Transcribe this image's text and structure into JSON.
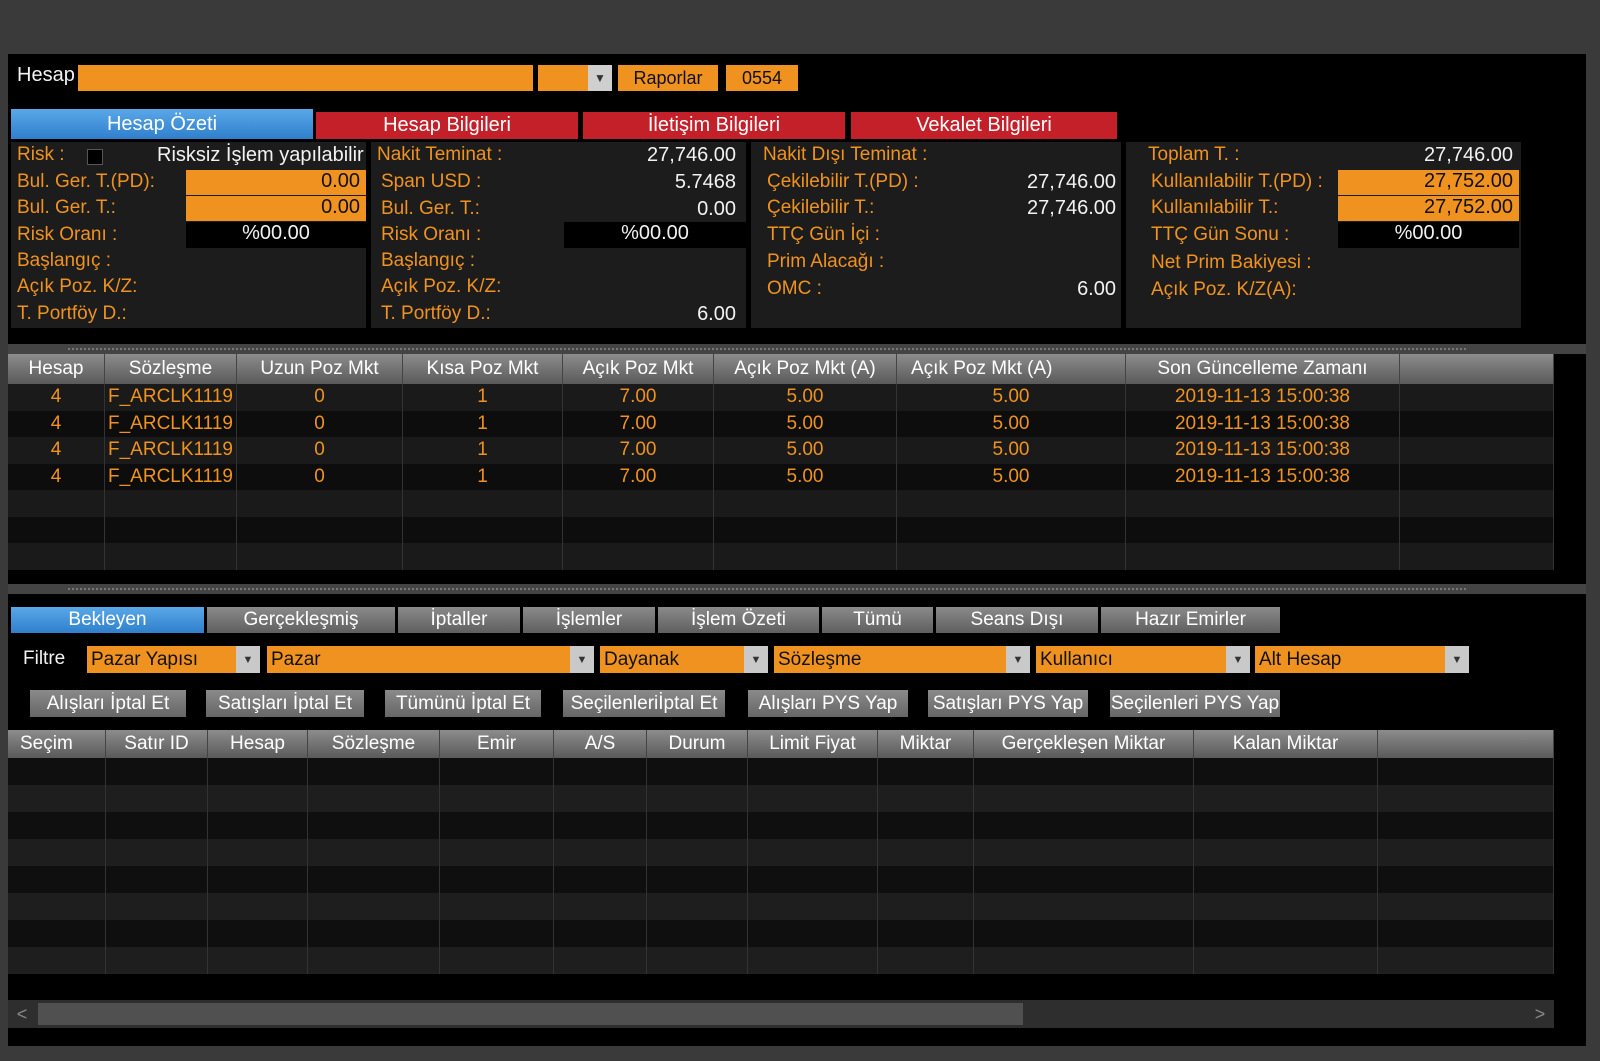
{
  "header": {
    "hesap_label": "Hesap",
    "raporlar_button": "Raporlar",
    "account_code": "0554"
  },
  "tabs": [
    {
      "label": "Hesap Özeti",
      "active": true
    },
    {
      "label": "Hesap Bilgileri"
    },
    {
      "label": "İletişim Bilgileri"
    },
    {
      "label": "Vekalet Bilgileri"
    }
  ],
  "summary": {
    "col1": {
      "risk_label": "Risk :",
      "risk_text": "Risksiz İşlem yapılabilir",
      "bul_ger_pd_label": "Bul. Ger. T.(PD):",
      "bul_ger_pd_value": "0.00",
      "bul_ger_label": "Bul. Ger. T.:",
      "bul_ger_value": "0.00",
      "risk_orani_label": "Risk Oranı :",
      "risk_orani_value": "%00.00",
      "baslangic_label": "Başlangıç  :",
      "acik_poz_label": "Açık Poz. K/Z:",
      "portfoy_label": "T. Portföy D.:"
    },
    "col2": {
      "nakit_label": "Nakit Teminat :",
      "nakit_value": "27,746.00",
      "span_label": "Span USD :",
      "span_value": "5.7468",
      "bul_ger_label": "Bul. Ger. T.:",
      "bul_ger_value": "0.00",
      "risk_orani_label": "Risk Oranı :",
      "risk_orani_value": "%00.00",
      "baslangic_label": "Başlangıç  :",
      "acik_poz_label": "Açık Poz. K/Z:",
      "portfoy_label": "T. Portföy D.:",
      "portfoy_value": "6.00"
    },
    "col3": {
      "nakit_disi_label": "Nakit Dışı  Teminat :",
      "cekilebilir_pd_label": "Çekilebilir T.(PD) :",
      "cekilebilir_pd_value": "27,746.00",
      "cekilebilir_label": "Çekilebilir T.:",
      "cekilebilir_value": "27,746.00",
      "ttc_gun_ici_label": "TTÇ Gün İçi :",
      "prim_alacagi_label": "Prim Alacağı :",
      "omc_label": "OMC :",
      "omc_value": "6.00"
    },
    "col4": {
      "toplam_label": "Toplam T. :",
      "toplam_value": "27,746.00",
      "kullanilabilir_pd_label": "Kullanılabilir T.(PD) :",
      "kullanilabilir_pd_value": "27,752.00",
      "kullanilabilir_label": "Kullanılabilir T.:",
      "kullanilabilir_value": "27,752.00",
      "ttc_gun_sonu_label": "TTÇ Gün Sonu :",
      "ttc_gun_sonu_value": "%00.00",
      "net_prim_label": "Net Prim Bakiyesi :",
      "acik_poz_a_label": "Açık Poz. K/Z(A):"
    }
  },
  "positions": {
    "headers": [
      "Hesap",
      "Sözleşme",
      "Uzun Poz Mkt",
      "Kısa Poz Mkt",
      "Açık Poz Mkt",
      "Açık Poz Mkt (A)",
      "Açık Poz Mkt (A)",
      "Son Güncelleme Zamanı"
    ],
    "rows": [
      [
        "4",
        "F_ARCLK1119",
        "0",
        "1",
        "7.00",
        "5.00",
        "5.00",
        "2019-11-13 15:00:38"
      ],
      [
        "4",
        "F_ARCLK1119",
        "0",
        "1",
        "7.00",
        "5.00",
        "5.00",
        "2019-11-13 15:00:38"
      ],
      [
        "4",
        "F_ARCLK1119",
        "0",
        "1",
        "7.00",
        "5.00",
        "5.00",
        "2019-11-13 15:00:38"
      ],
      [
        "4",
        "F_ARCLK1119",
        "0",
        "1",
        "7.00",
        "5.00",
        "5.00",
        "2019-11-13 15:00:38"
      ]
    ]
  },
  "order_tabs": [
    {
      "label": "Bekleyen",
      "active": true
    },
    {
      "label": "Gerçekleşmiş"
    },
    {
      "label": "İptaller"
    },
    {
      "label": "İşlemler"
    },
    {
      "label": "İşlem Özeti"
    },
    {
      "label": "Tümü"
    },
    {
      "label": "Seans Dışı"
    },
    {
      "label": "Hazır Emirler"
    }
  ],
  "filter": {
    "label": "Filtre",
    "dropdowns": [
      "Pazar Yapısı",
      "Pazar",
      "Dayanak",
      "Sözleşme",
      "Kullanıcı",
      "Alt Hesap"
    ]
  },
  "actions": [
    "Alışları İptal Et",
    "Satışları İptal Et",
    "Tümünü İptal Et",
    "Seçilenleriİptal Et",
    "Alışları PYS Yap",
    "Satışları PYS Yap",
    "Seçilenleri PYS Yap"
  ],
  "orders": {
    "headers": [
      "Seçim",
      "Satır ID",
      "Hesap",
      "Sözleşme",
      "Emir",
      "A/S",
      "Durum",
      "Limit Fiyat",
      "Miktar",
      "Gerçekleşen Miktar",
      "Kalan Miktar"
    ]
  },
  "colors": {
    "accent_orange": "#f0921f",
    "tab_blue": "#3d8fd8",
    "tab_red": "#c3202a"
  }
}
